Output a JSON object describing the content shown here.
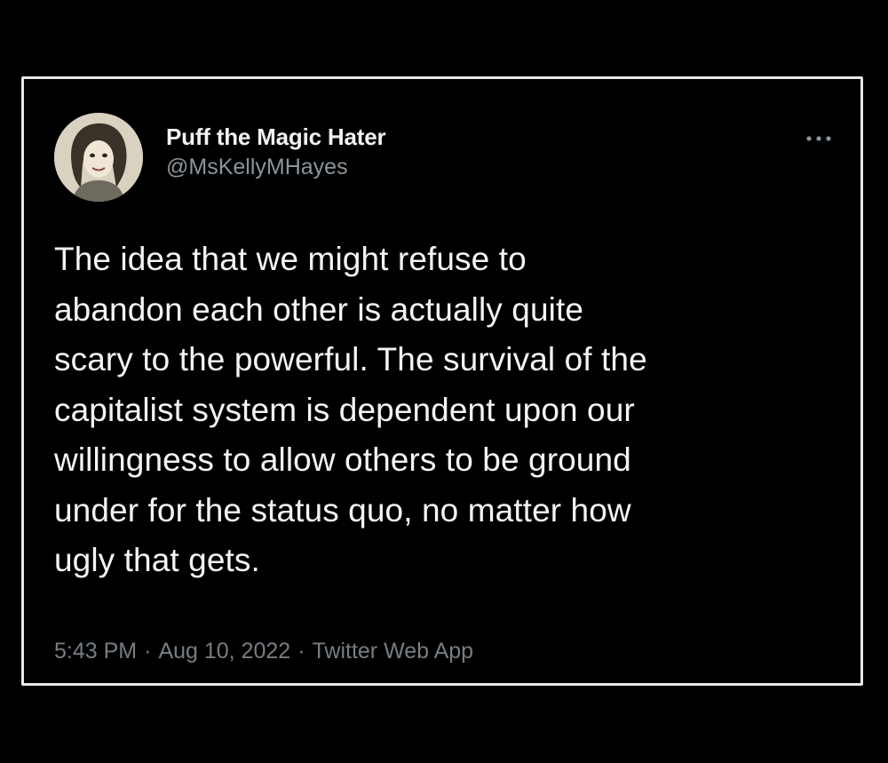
{
  "tweet": {
    "display_name": "Puff the Magic Hater",
    "handle": "@MsKellyMHayes",
    "text": "The idea that we might refuse to\nabandon each other is actually quite\nscary to the powerful. The survival of the\ncapitalist system is dependent upon our\nwillingness to allow others to be ground\nunder for the status quo, no matter how\nugly that gets.",
    "time": "5:43 PM",
    "date": "Aug 10, 2022",
    "source": "Twitter Web App",
    "separator": "·",
    "more_icon": "more-horizontal-icon",
    "avatar_icon": "avatar-drawing"
  },
  "colors": {
    "background": "#000000",
    "text": "#f4f4f4",
    "secondary_text": "#8b949b",
    "frame_border": "#e8e8e8"
  }
}
